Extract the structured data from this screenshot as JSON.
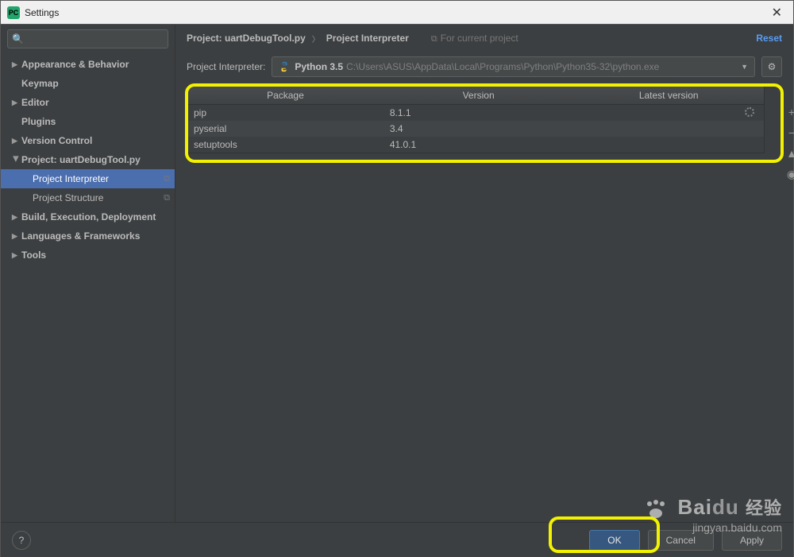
{
  "window": {
    "title": "Settings",
    "icon_letters": "PC"
  },
  "search": {
    "placeholder": ""
  },
  "tree": {
    "items": [
      {
        "label": "Appearance & Behavior",
        "arrow": true,
        "bold": true
      },
      {
        "label": "Keymap",
        "arrow": false,
        "bold": true
      },
      {
        "label": "Editor",
        "arrow": true,
        "bold": true
      },
      {
        "label": "Plugins",
        "arrow": false,
        "bold": true
      },
      {
        "label": "Version Control",
        "arrow": true,
        "bold": true
      },
      {
        "label": "Project: uartDebugTool.py",
        "arrow": true,
        "bold": true,
        "expanded": true
      },
      {
        "label": "Project Interpreter",
        "child": true,
        "selected": true,
        "suffix": "⧉"
      },
      {
        "label": "Project Structure",
        "child": true,
        "suffix": "⧉"
      },
      {
        "label": "Build, Execution, Deployment",
        "arrow": true,
        "bold": true
      },
      {
        "label": "Languages & Frameworks",
        "arrow": true,
        "bold": true
      },
      {
        "label": "Tools",
        "arrow": true,
        "bold": true
      }
    ]
  },
  "breadcrumb": {
    "parent": "Project: uartDebugTool.py",
    "child": "Project Interpreter",
    "hint": "For current project",
    "reset": "Reset"
  },
  "interpreter": {
    "label": "Project Interpreter:",
    "name": "Python 3.5",
    "path": "C:\\Users\\ASUS\\AppData\\Local\\Programs\\Python\\Python35-32\\python.exe"
  },
  "table": {
    "columns": {
      "pkg": "Package",
      "ver": "Version",
      "lat": "Latest version"
    },
    "rows": [
      {
        "pkg": "pip",
        "ver": "8.1.1",
        "lat": ""
      },
      {
        "pkg": "pyserial",
        "ver": "3.4",
        "lat": ""
      },
      {
        "pkg": "setuptools",
        "ver": "41.0.1",
        "lat": ""
      }
    ]
  },
  "buttons": {
    "ok": "OK",
    "cancel": "Cancel",
    "apply": "Apply"
  },
  "watermark": {
    "brand": "Bai",
    "brand2": "du",
    "cn": "经验",
    "sub": "jingyan.baidu.com"
  }
}
